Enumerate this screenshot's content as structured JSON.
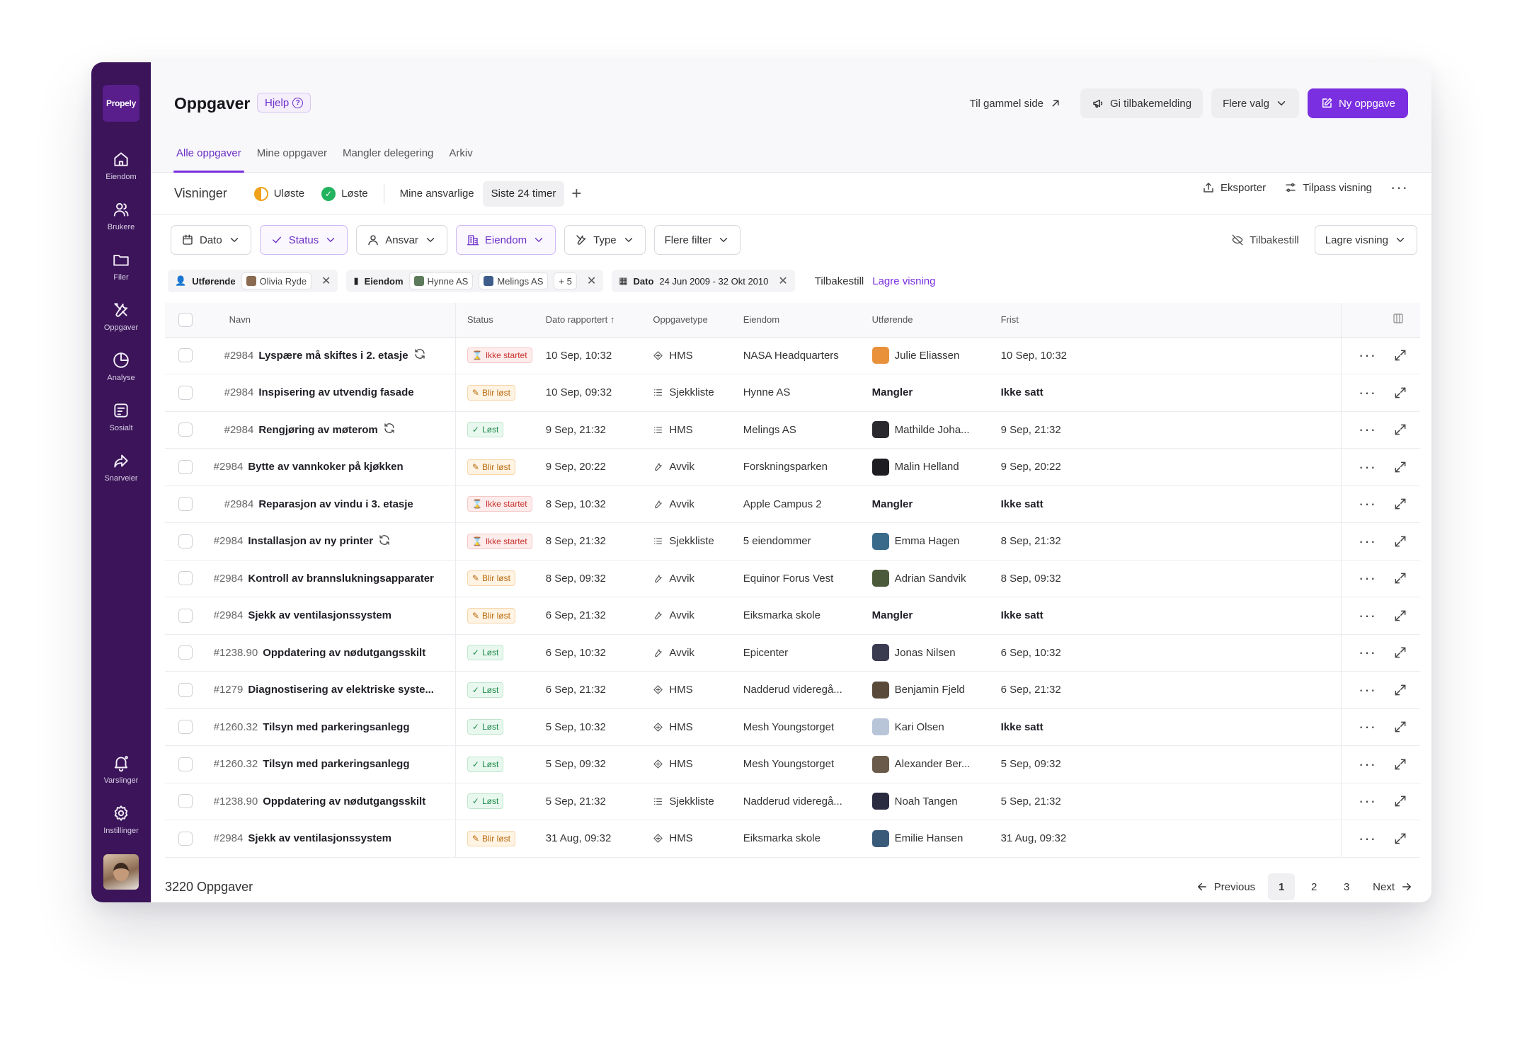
{
  "app": {
    "logo": "Propely"
  },
  "sidebar": {
    "items": [
      {
        "label": "Eiendom",
        "icon": "home-icon"
      },
      {
        "label": "Brukere",
        "icon": "users-icon"
      },
      {
        "label": "Filer",
        "icon": "folder-icon"
      },
      {
        "label": "Oppgaver",
        "icon": "tools-icon"
      },
      {
        "label": "Analyse",
        "icon": "pie-chart-icon"
      },
      {
        "label": "Sosialt",
        "icon": "social-icon"
      },
      {
        "label": "Snarveier",
        "icon": "shortcut-icon"
      }
    ],
    "bottom": [
      {
        "label": "Varslinger",
        "icon": "bell-icon"
      },
      {
        "label": "Instillinger",
        "icon": "gear-icon"
      }
    ]
  },
  "header": {
    "title": "Oppgaver",
    "help": "Hjelp",
    "old_page": "Til gammel side",
    "feedback": "Gi tilbakemelding",
    "more": "Flere valg",
    "new_task": "Ny oppgave"
  },
  "tabs": [
    "Alle oppgaver",
    "Mine oppgaver",
    "Mangler delegering",
    "Arkiv"
  ],
  "views": {
    "label": "Visninger",
    "unresolved": "Uløste",
    "resolved": "Løste",
    "mine": "Mine ansvarlige",
    "last24": "Siste 24 timer",
    "plus": "+",
    "export": "Eksporter",
    "customize": "Tilpass visning"
  },
  "filters": {
    "buttons": [
      "Dato",
      "Status",
      "Ansvar",
      "Eiendom",
      "Type",
      "Flere filter"
    ],
    "reset": "Tilbakestill",
    "save_view": "Lagre visning"
  },
  "active_filters": {
    "performer_label": "Utførende",
    "performer_value": "Olivia Ryde",
    "property_label": "Eiendom",
    "property_values": [
      "Hynne AS",
      "Melings AS"
    ],
    "property_more": "+ 5",
    "date_label": "Dato",
    "date_value": "24 Jun 2009 - 32 Okt 2010",
    "reset": "Tilbakestill",
    "save_view": "Lagre visning"
  },
  "table": {
    "columns": [
      "Navn",
      "Status",
      "Dato rapportert",
      "Oppgavetype",
      "Eiendom",
      "Utførende",
      "Frist"
    ],
    "rows": [
      {
        "unread": true,
        "id": "#2984",
        "title": "Lyspære må skiftes i 2. etasje",
        "sync": true,
        "status": "Ikke startet",
        "status_kind": "red",
        "date": "10 Sep, 10:32",
        "type": "HMS",
        "type_icon": "hms-icon",
        "property": "NASA Headquarters",
        "performer": "Julie Eliassen",
        "performer_color": "#e8913a",
        "performer_bold": false,
        "due": "10 Sep, 10:32",
        "due_bold": false
      },
      {
        "unread": true,
        "id": "#2984",
        "title": "Inspisering av utvendig fasade",
        "sync": false,
        "status": "Blir løst",
        "status_kind": "orange",
        "date": "10 Sep, 09:32",
        "type": "Sjekkliste",
        "type_icon": "list-icon",
        "property": "Hynne AS",
        "performer": "Mangler",
        "performer_color": "",
        "performer_bold": true,
        "due": "Ikke satt",
        "due_bold": true
      },
      {
        "unread": true,
        "id": "#2984",
        "title": "Rengjøring av møterom",
        "sync": true,
        "status": "Løst",
        "status_kind": "green",
        "date": "9 Sep, 21:32",
        "type": "HMS",
        "type_icon": "list-icon",
        "property": "Melings AS",
        "performer": "Mathilde Joha...",
        "performer_color": "#2a2a2e",
        "performer_bold": false,
        "due": "9 Sep, 21:32",
        "due_bold": false
      },
      {
        "unread": false,
        "id": "#2984",
        "title": "Bytte av vannkoker på kjøkken",
        "sync": false,
        "status": "Blir løst",
        "status_kind": "orange",
        "date": "9 Sep, 20:22",
        "type": "Avvik",
        "type_icon": "wrench-icon",
        "property": "Forskningsparken",
        "performer": "Malin Helland",
        "performer_color": "#1e1e22",
        "performer_bold": false,
        "due": "9 Sep, 20:22",
        "due_bold": false
      },
      {
        "unread": true,
        "id": "#2984",
        "title": "Reparasjon av vindu i 3. etasje",
        "sync": false,
        "status": "Ikke startet",
        "status_kind": "red",
        "date": "8 Sep, 10:32",
        "type": "Avvik",
        "type_icon": "wrench-icon",
        "property": "Apple Campus 2",
        "performer": "Mangler",
        "performer_color": "",
        "performer_bold": true,
        "due": "Ikke satt",
        "due_bold": true
      },
      {
        "unread": false,
        "id": "#2984",
        "title": "Installasjon av ny printer",
        "sync": true,
        "status": "Ikke startet",
        "status_kind": "red",
        "date": "8 Sep, 21:32",
        "type": "Sjekkliste",
        "type_icon": "list-icon",
        "property": "5 eiendommer",
        "performer": "Emma Hagen",
        "performer_color": "#3a6a8a",
        "performer_bold": false,
        "due": "8 Sep, 21:32",
        "due_bold": false
      },
      {
        "unread": false,
        "id": "#2984",
        "title": "Kontroll av brannslukningsapparater",
        "sync": false,
        "status": "Blir løst",
        "status_kind": "orange",
        "date": "8 Sep, 09:32",
        "type": "Avvik",
        "type_icon": "wrench-icon",
        "property": "Equinor Forus Vest",
        "performer": "Adrian Sandvik",
        "performer_color": "#4a5a3a",
        "performer_bold": false,
        "due": "8 Sep, 09:32",
        "due_bold": false
      },
      {
        "unread": false,
        "id": "#2984",
        "title": "Sjekk av ventilasjonssystem",
        "sync": false,
        "status": "Blir løst",
        "status_kind": "orange",
        "date": "6 Sep, 21:32",
        "type": "Avvik",
        "type_icon": "wrench-icon",
        "property": "Eiksmarka skole",
        "performer": "Mangler",
        "performer_color": "",
        "performer_bold": true,
        "due": "Ikke satt",
        "due_bold": true
      },
      {
        "unread": false,
        "id": "#1238.90",
        "title": "Oppdatering av nødutgangsskilt",
        "sync": false,
        "status": "Løst",
        "status_kind": "green",
        "date": "6 Sep, 10:32",
        "type": "Avvik",
        "type_icon": "wrench-icon",
        "property": "Epicenter",
        "performer": "Jonas Nilsen",
        "performer_color": "#3a3a50",
        "performer_bold": false,
        "due": "6 Sep, 10:32",
        "due_bold": false
      },
      {
        "unread": false,
        "id": "#1279",
        "title": "Diagnostisering av elektriske syste...",
        "sync": false,
        "status": "Løst",
        "status_kind": "green",
        "date": "6 Sep, 21:32",
        "type": "HMS",
        "type_icon": "hms-icon",
        "property": "Nadderud videregå...",
        "performer": "Benjamin Fjeld",
        "performer_color": "#5a4a3a",
        "performer_bold": false,
        "due": "6 Sep, 21:32",
        "due_bold": false
      },
      {
        "unread": false,
        "id": "#1260.32",
        "title": "Tilsyn med parkeringsanlegg",
        "sync": false,
        "status": "Løst",
        "status_kind": "green",
        "date": "5 Sep, 10:32",
        "type": "HMS",
        "type_icon": "hms-icon",
        "property": "Mesh Youngstorget",
        "performer": "Kari Olsen",
        "performer_color": "#b8c4d8",
        "performer_bold": false,
        "due": "Ikke satt",
        "due_bold": true
      },
      {
        "unread": false,
        "id": "#1260.32",
        "title": "Tilsyn med parkeringsanlegg",
        "sync": false,
        "status": "Løst",
        "status_kind": "green",
        "date": "5 Sep, 09:32",
        "type": "HMS",
        "type_icon": "hms-icon",
        "property": "Mesh Youngstorget",
        "performer": "Alexander Ber...",
        "performer_color": "#6a5a4a",
        "performer_bold": false,
        "due": "5 Sep, 09:32",
        "due_bold": false
      },
      {
        "unread": false,
        "id": "#1238.90",
        "title": "Oppdatering av nødutgangsskilt",
        "sync": false,
        "status": "Løst",
        "status_kind": "green",
        "date": "5 Sep, 21:32",
        "type": "Sjekkliste",
        "type_icon": "list-icon",
        "property": "Nadderud videregå...",
        "performer": "Noah Tangen",
        "performer_color": "#2a2a40",
        "performer_bold": false,
        "due": "5 Sep, 21:32",
        "due_bold": false
      },
      {
        "unread": false,
        "id": "#2984",
        "title": "Sjekk av ventilasjonssystem",
        "sync": false,
        "status": "Blir løst",
        "status_kind": "orange",
        "date": "31 Aug, 09:32",
        "type": "HMS",
        "type_icon": "hms-icon",
        "property": "Eiksmarka skole",
        "performer": "Emilie Hansen",
        "performer_color": "#3a5a7a",
        "performer_bold": false,
        "due": "31 Aug, 09:32",
        "due_bold": false
      }
    ]
  },
  "footer": {
    "count": "3220 Oppgaver",
    "previous": "Previous",
    "next": "Next",
    "pages": [
      "1",
      "2",
      "3"
    ],
    "current_page": "1"
  },
  "colors": {
    "sidebar": "#3b1459",
    "accent": "#7a2fe0"
  }
}
